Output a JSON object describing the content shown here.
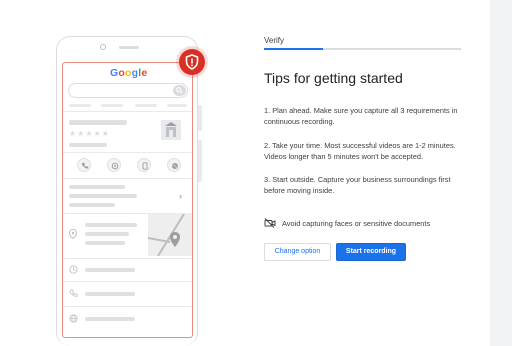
{
  "phone": {
    "logo_letters": [
      {
        "char": "G",
        "color": "#4285f4"
      },
      {
        "char": "o",
        "color": "#ea4335"
      },
      {
        "char": "o",
        "color": "#fbbc05"
      },
      {
        "char": "g",
        "color": "#4285f4"
      },
      {
        "char": "l",
        "color": "#34a853"
      },
      {
        "char": "e",
        "color": "#ea4335"
      }
    ],
    "stars": "★★★★★",
    "chevron": "›",
    "warning_icon": "shield-alert-icon"
  },
  "header": {
    "step_label": "Verify",
    "progress": 0.3
  },
  "main": {
    "title": "Tips for getting started",
    "tips": [
      "1. Plan ahead. Make sure you capture all 3 requirements in continuous recording.",
      "2. Take your time. Most successful videos are 1-2 minutes. Videos longer than 5 minutes won't be accepted.",
      "3. Start outside. Capture your business surroundings first before moving inside."
    ],
    "note": "Avoid capturing faces or sensitive documents"
  },
  "actions": {
    "change_label": "Change option",
    "start_label": "Start recording"
  },
  "colors": {
    "accent": "#1a73e8",
    "warning": "#d93025",
    "outline": "#ea8b80"
  }
}
